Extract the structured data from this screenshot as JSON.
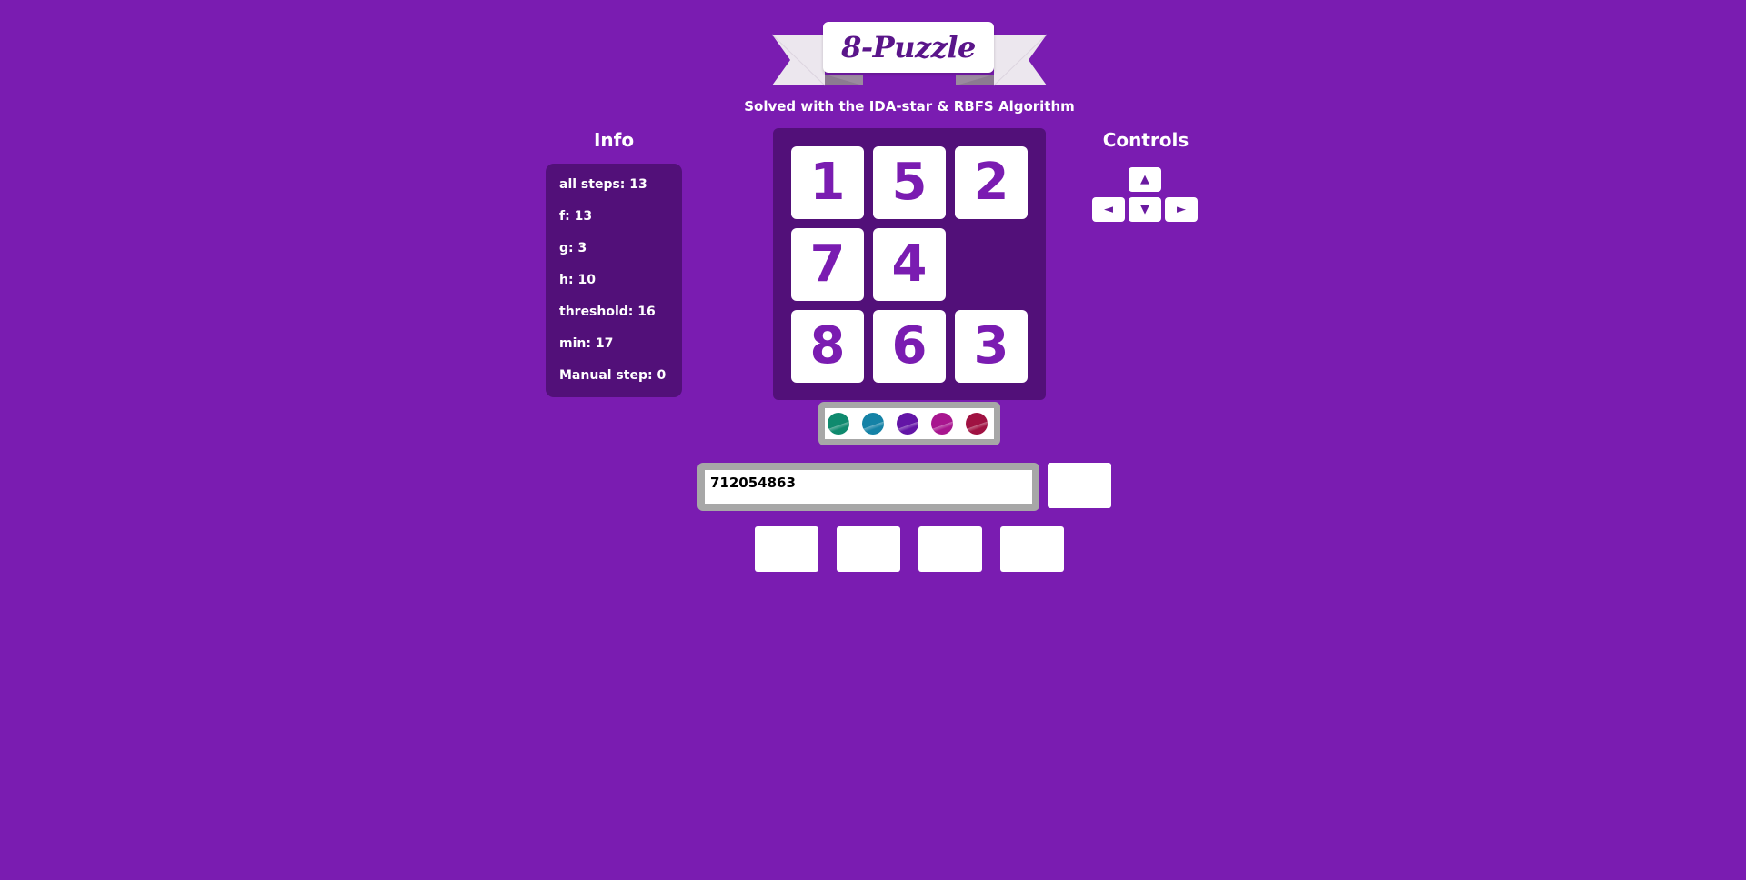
{
  "title": "8-Puzzle",
  "subtitle": "Solved with the IDA-star & RBFS Algorithm",
  "info": {
    "heading": "Info",
    "rows": [
      {
        "label": "all steps",
        "value": "13"
      },
      {
        "label": "f",
        "value": "13"
      },
      {
        "label": "g",
        "value": "3"
      },
      {
        "label": "h",
        "value": "10"
      },
      {
        "label": "threshold",
        "value": "16"
      },
      {
        "label": "min",
        "value": "17"
      },
      {
        "label": "Manual step",
        "value": "0"
      }
    ]
  },
  "board": {
    "grid": [
      [
        "1",
        "5",
        "2"
      ],
      [
        "7",
        "4",
        ""
      ],
      [
        "8",
        "6",
        "3"
      ]
    ]
  },
  "controls": {
    "heading": "Controls",
    "up": "▲",
    "left": "◄",
    "down": "▼",
    "right": "►"
  },
  "colors": {
    "background": "#7a1cb1",
    "panel": "#521079",
    "tile_text": "#7a1cb1",
    "swatches": [
      "#0f8a6e",
      "#1582a6",
      "#6315a6",
      "#a8168f",
      "#a01242"
    ]
  },
  "state_input": {
    "value": "712054863"
  }
}
